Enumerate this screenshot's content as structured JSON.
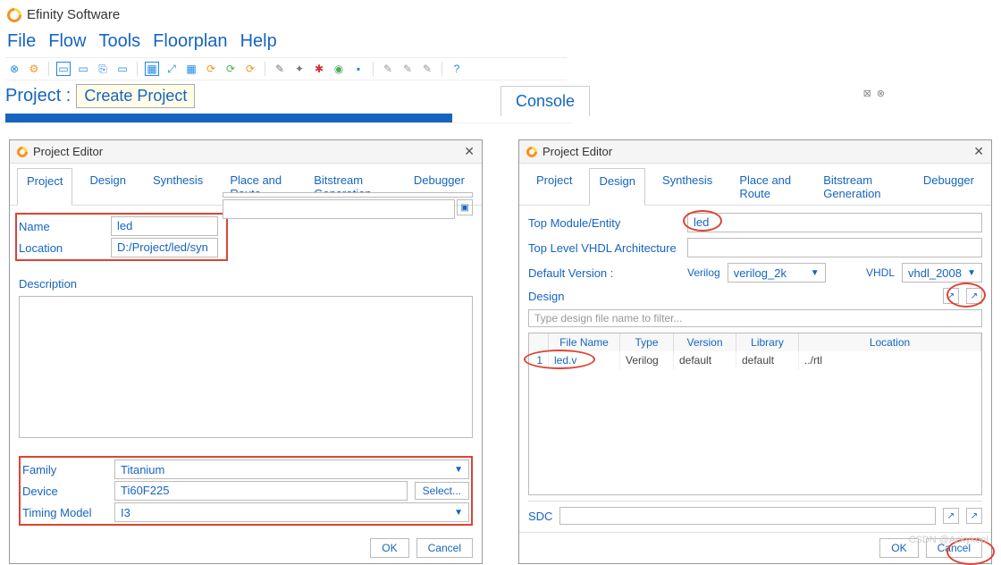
{
  "app": {
    "title": "Efinity Software"
  },
  "menubar": [
    "File",
    "Flow",
    "Tools",
    "Floorplan",
    "Help"
  ],
  "projectRow": {
    "label": "Project :",
    "buttonTooltip": "Create Project"
  },
  "console": {
    "tab": "Console"
  },
  "dialog1": {
    "title": "Project Editor",
    "tabs": [
      "Project",
      "Design",
      "Synthesis",
      "Place and Route",
      "Bitstream Generation",
      "Debugger"
    ],
    "activeTab": "Project",
    "fields": {
      "nameLabel": "Name",
      "name": "led",
      "locationLabel": "Location",
      "location": "D:/Project/led/syn",
      "descLabel": "Description",
      "familyLabel": "Family",
      "family": "Titanium",
      "deviceLabel": "Device",
      "device": "Ti60F225",
      "selectBtn": "Select...",
      "timingLabel": "Timing Model",
      "timing": "I3"
    },
    "buttons": {
      "ok": "OK",
      "cancel": "Cancel"
    }
  },
  "dialog2": {
    "title": "Project Editor",
    "tabs": [
      "Project",
      "Design",
      "Synthesis",
      "Place and Route",
      "Bitstream Generation",
      "Debugger"
    ],
    "activeTab": "Design",
    "fields": {
      "topModuleLabel": "Top Module/Entity",
      "topModule": "led",
      "topArchLabel": "Top Level VHDL Architecture",
      "topArch": "",
      "defaultVersionLabel": "Default Version :",
      "verilogLabel": "Verilog",
      "verilog": "verilog_2k",
      "vhdlLabel": "VHDL",
      "vhdl": "vhdl_2008",
      "designLabel": "Design",
      "filterPlaceholder": "Type design file name to filter...",
      "sdcLabel": "SDC"
    },
    "table": {
      "headers": [
        "",
        "File Name",
        "Type",
        "Version",
        "Library",
        "Location"
      ],
      "rows": [
        {
          "idx": "1",
          "file": "led.v",
          "type": "Verilog",
          "version": "default",
          "library": "default",
          "location": "../rtl"
        }
      ]
    },
    "buttons": {
      "ok": "OK",
      "cancel": "Cancel"
    }
  },
  "watermark": "CSDN @Ackykoel"
}
